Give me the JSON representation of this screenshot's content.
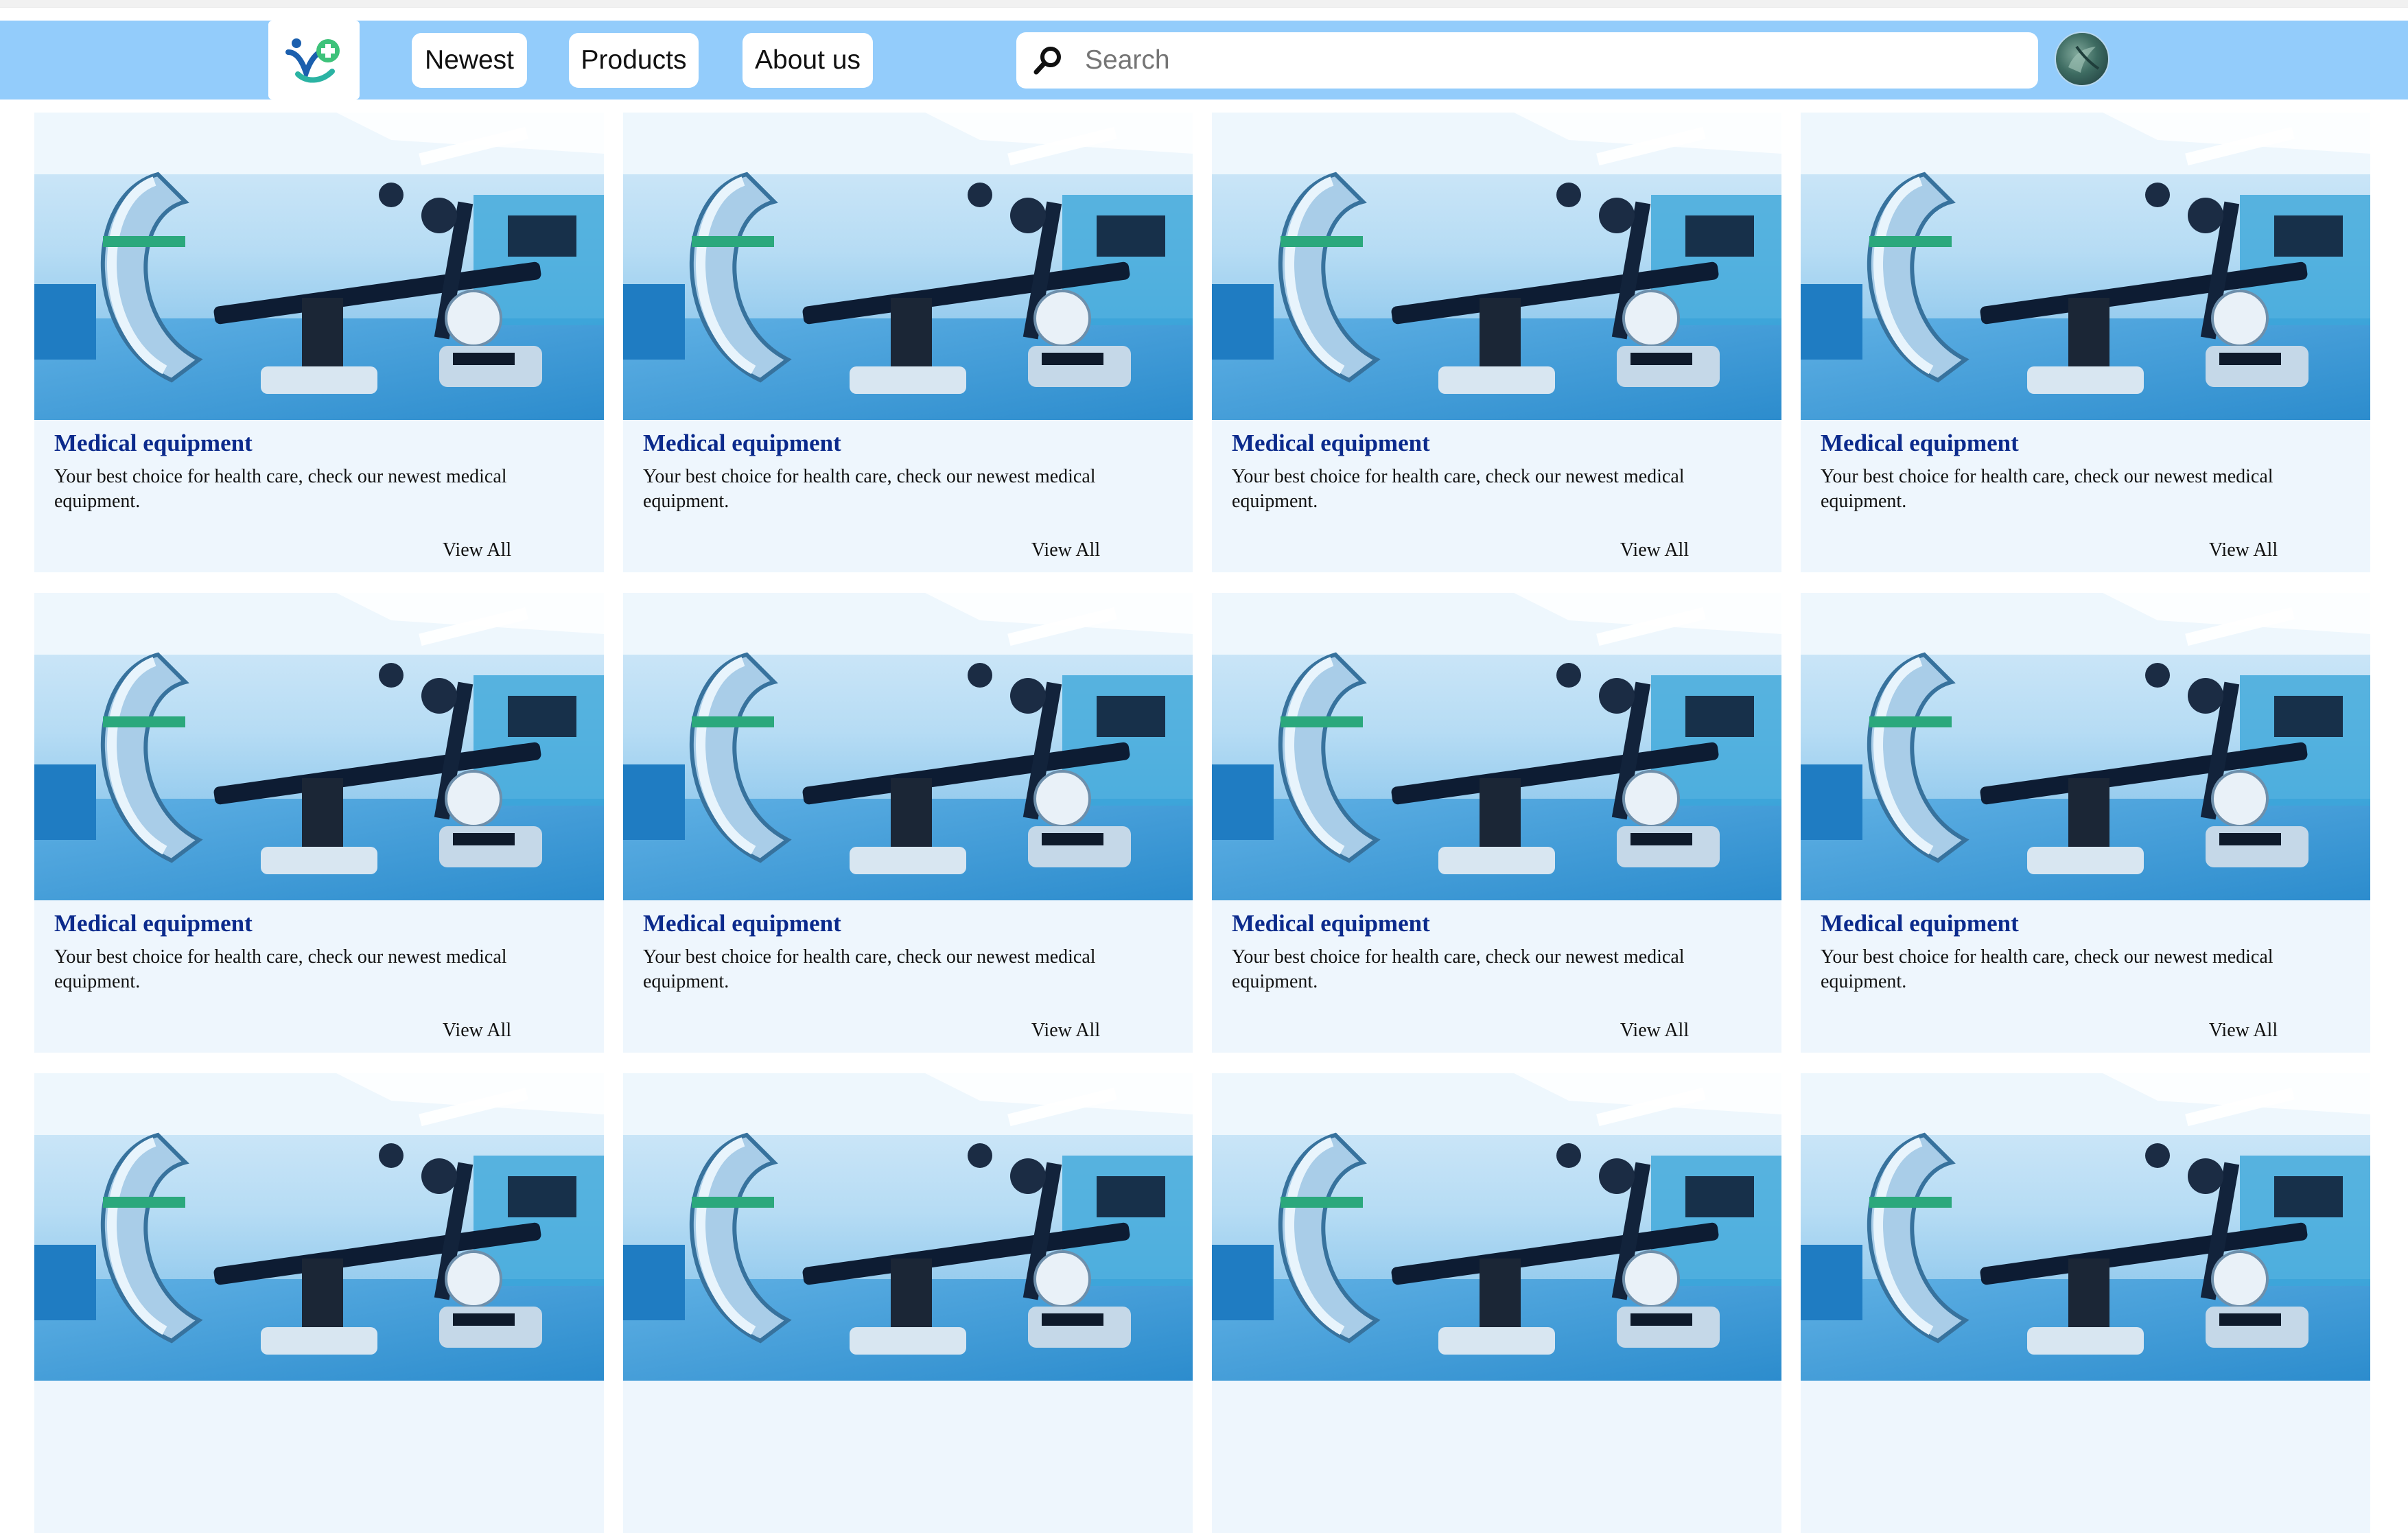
{
  "header": {
    "nav": [
      "Newest",
      "Products",
      "About us"
    ],
    "search_placeholder": "Search",
    "logo_icon": "health-plus-logo-icon",
    "avatar_icon": "avatar"
  },
  "colors": {
    "header_bg": "#93ccfb",
    "card_bg": "#eef6fd",
    "title_color": "#0b2a8c"
  },
  "cards": [
    {
      "title": "Medical equipment",
      "description": "Your best choice for health care, check our newest medical equipment.",
      "link": "View All"
    },
    {
      "title": "Medical equipment",
      "description": "Your best choice for health care, check our newest medical equipment.",
      "link": "View All"
    },
    {
      "title": "Medical equipment",
      "description": "Your best choice for health care, check our newest medical equipment.",
      "link": "View All"
    },
    {
      "title": "Medical equipment",
      "description": "Your best choice for health care, check our newest medical equipment.",
      "link": "View All"
    },
    {
      "title": "Medical equipment",
      "description": "Your best choice for health care, check our newest medical equipment.",
      "link": "View All"
    },
    {
      "title": "Medical equipment",
      "description": "Your best choice for health care, check our newest medical equipment.",
      "link": "View All"
    },
    {
      "title": "Medical equipment",
      "description": "Your best choice for health care, check our newest medical equipment.",
      "link": "View All"
    },
    {
      "title": "Medical equipment",
      "description": "Your best choice for health care, check our newest medical equipment.",
      "link": "View All"
    },
    {
      "title": "",
      "description": "",
      "link": ""
    },
    {
      "title": "",
      "description": "",
      "link": ""
    },
    {
      "title": "",
      "description": "",
      "link": ""
    },
    {
      "title": "",
      "description": "",
      "link": ""
    }
  ]
}
